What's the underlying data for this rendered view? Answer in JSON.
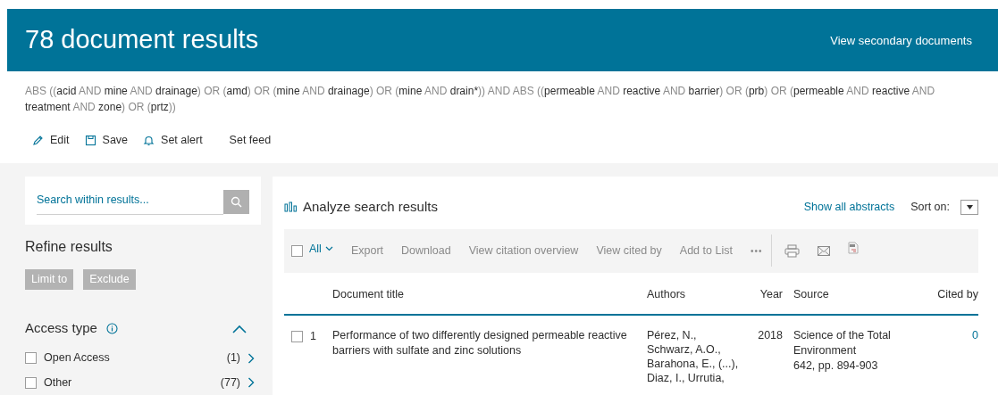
{
  "header": {
    "title": "78 document results",
    "link": "View secondary documents"
  },
  "query": [
    {
      "text": "ABS",
      "kind": "op"
    },
    {
      "text": "((",
      "kind": "op"
    },
    {
      "text": "acid",
      "kind": "term"
    },
    {
      "text": "AND",
      "kind": "op"
    },
    {
      "text": "mine",
      "kind": "term"
    },
    {
      "text": "AND",
      "kind": "op"
    },
    {
      "text": "drainage",
      "kind": "term"
    },
    {
      "text": ")",
      "kind": "op"
    },
    {
      "text": "OR",
      "kind": "op"
    },
    {
      "text": "(",
      "kind": "op"
    },
    {
      "text": "amd",
      "kind": "term"
    },
    {
      "text": ")",
      "kind": "op"
    },
    {
      "text": "OR",
      "kind": "op"
    },
    {
      "text": "(",
      "kind": "op"
    },
    {
      "text": "mine",
      "kind": "term"
    },
    {
      "text": "AND",
      "kind": "op"
    },
    {
      "text": "drainage",
      "kind": "term"
    },
    {
      "text": ")",
      "kind": "op"
    },
    {
      "text": "OR",
      "kind": "op"
    },
    {
      "text": "(",
      "kind": "op"
    },
    {
      "text": "mine",
      "kind": "term"
    },
    {
      "text": "AND",
      "kind": "op"
    },
    {
      "text": "drain*",
      "kind": "term"
    },
    {
      "text": "))",
      "kind": "op"
    },
    {
      "text": "AND",
      "kind": "op"
    },
    {
      "text": "ABS",
      "kind": "op"
    },
    {
      "text": "((",
      "kind": "op"
    },
    {
      "text": "permeable",
      "kind": "term"
    },
    {
      "text": "AND",
      "kind": "op"
    },
    {
      "text": "reactive",
      "kind": "term"
    },
    {
      "text": "AND",
      "kind": "op"
    },
    {
      "text": "barrier",
      "kind": "term"
    },
    {
      "text": ")",
      "kind": "op"
    },
    {
      "text": "OR",
      "kind": "op"
    },
    {
      "text": "(",
      "kind": "op"
    },
    {
      "text": "prb",
      "kind": "term"
    },
    {
      "text": ")",
      "kind": "op"
    },
    {
      "text": "OR",
      "kind": "op"
    },
    {
      "text": "(",
      "kind": "op"
    },
    {
      "text": "permeable",
      "kind": "term"
    },
    {
      "text": "AND",
      "kind": "op"
    },
    {
      "text": "reactive",
      "kind": "term"
    },
    {
      "text": "AND",
      "kind": "op"
    },
    {
      "text": "treatment",
      "kind": "term"
    },
    {
      "text": "AND",
      "kind": "op"
    },
    {
      "text": "zone",
      "kind": "term"
    },
    {
      "text": ")",
      "kind": "op"
    },
    {
      "text": "OR",
      "kind": "op"
    },
    {
      "text": "(",
      "kind": "op"
    },
    {
      "text": "prtz",
      "kind": "term"
    },
    {
      "text": "))",
      "kind": "op"
    }
  ],
  "query_actions": [
    {
      "label": "Edit",
      "kind": "edit"
    },
    {
      "label": "Save",
      "kind": "save"
    },
    {
      "label": "Set alert",
      "kind": "alert"
    },
    {
      "label": "Set feed",
      "kind": "feed"
    }
  ],
  "sidebar": {
    "search": {
      "placeholder": "Search within results..."
    },
    "refine_title": "Refine results",
    "refine_buttons": [
      "Limit to",
      "Exclude"
    ],
    "facet": {
      "title": "Access type",
      "expanded": true,
      "items": [
        {
          "label": "Open Access",
          "count": "(1)",
          "checked": false
        },
        {
          "label": "Other",
          "count": "(77)",
          "checked": false
        }
      ]
    }
  },
  "results": {
    "analyze": "Analyze search results",
    "show_abstracts": "Show all abstracts",
    "sort_label": "Sort on:",
    "toolbar": {
      "all_label": "All",
      "all_checked": false,
      "actions": [
        "Export",
        "Download",
        "View citation overview",
        "View cited by",
        "Add to List"
      ],
      "more": "•••"
    },
    "columns": [
      "Document title",
      "Authors",
      "Year",
      "Source",
      "Cited by"
    ],
    "rows": [
      {
        "number": "1",
        "checked": false,
        "title": "Performance of two differently designed permeable reactive barriers with sulfate and zinc solutions",
        "authors": [
          "Pérez, N.,",
          "Schwarz, A.O.,",
          "Barahona, E., (...),",
          "Diaz, I., Urrutia,"
        ],
        "year": "2018",
        "source": [
          "Science of the Total",
          "Environment",
          "642, pp. 894-903"
        ],
        "cited_by": "0"
      }
    ]
  }
}
